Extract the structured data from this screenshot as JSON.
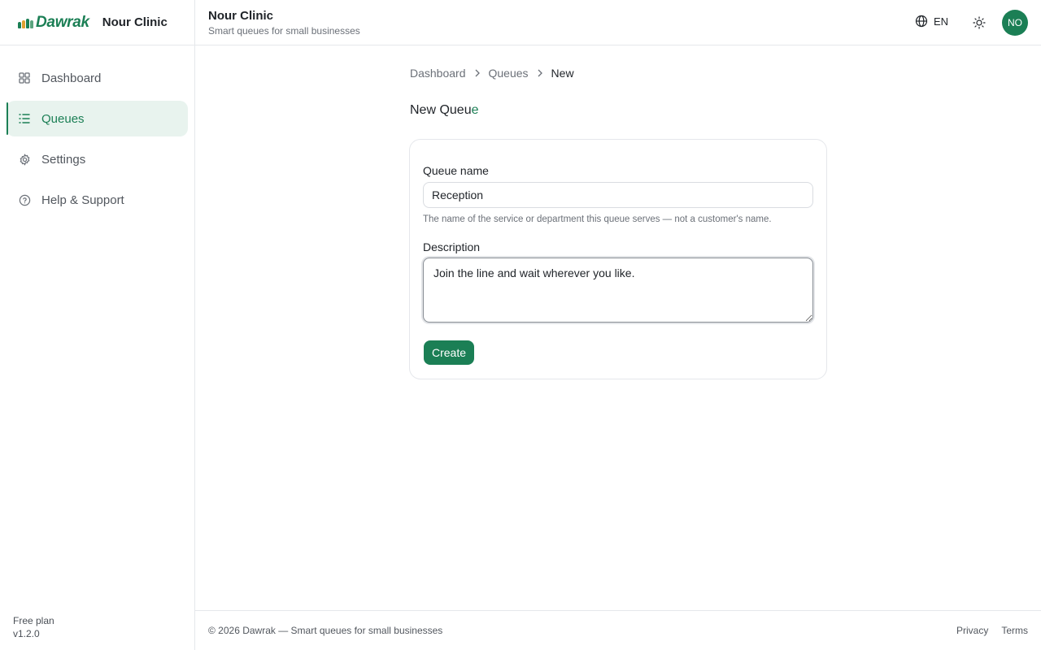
{
  "brand": {
    "logo_text": "Dawrak",
    "org_name": "Nour Clinic",
    "logo_colors": [
      "#1b7f55",
      "#e0a030",
      "#1b7f55",
      "#5aa47e"
    ]
  },
  "sidebar": {
    "items": [
      {
        "label": "Dashboard",
        "icon": "grid-icon",
        "active": false
      },
      {
        "label": "Queues",
        "icon": "list-icon",
        "active": true
      },
      {
        "label": "Settings",
        "icon": "gear-icon",
        "active": false
      },
      {
        "label": "Help & Support",
        "icon": "help-circle-icon",
        "active": false
      }
    ],
    "plan": "Free plan",
    "version": "v1.2.0"
  },
  "header": {
    "title": "Nour Clinic",
    "subtitle": "Smart queues for small businesses",
    "language": "EN",
    "avatar_initials": "NO"
  },
  "breadcrumb": [
    "Dashboard",
    "Queues",
    "New"
  ],
  "page": {
    "title_main": "New Queu",
    "title_accent": "e"
  },
  "form": {
    "name_label": "Queue name",
    "name_value": "Reception",
    "name_hint": "The name of the service or department this queue serves — not a customer's name.",
    "description_label": "Description",
    "description_value": "Join the line and wait wherever you like.",
    "submit_label": "Create"
  },
  "footer": {
    "copyright": "© 2026 Dawrak — Smart queues for small businesses",
    "links": [
      "Privacy",
      "Terms"
    ]
  },
  "colors": {
    "accent": "#1b7f55",
    "accent_bg": "#e8f3ee"
  }
}
